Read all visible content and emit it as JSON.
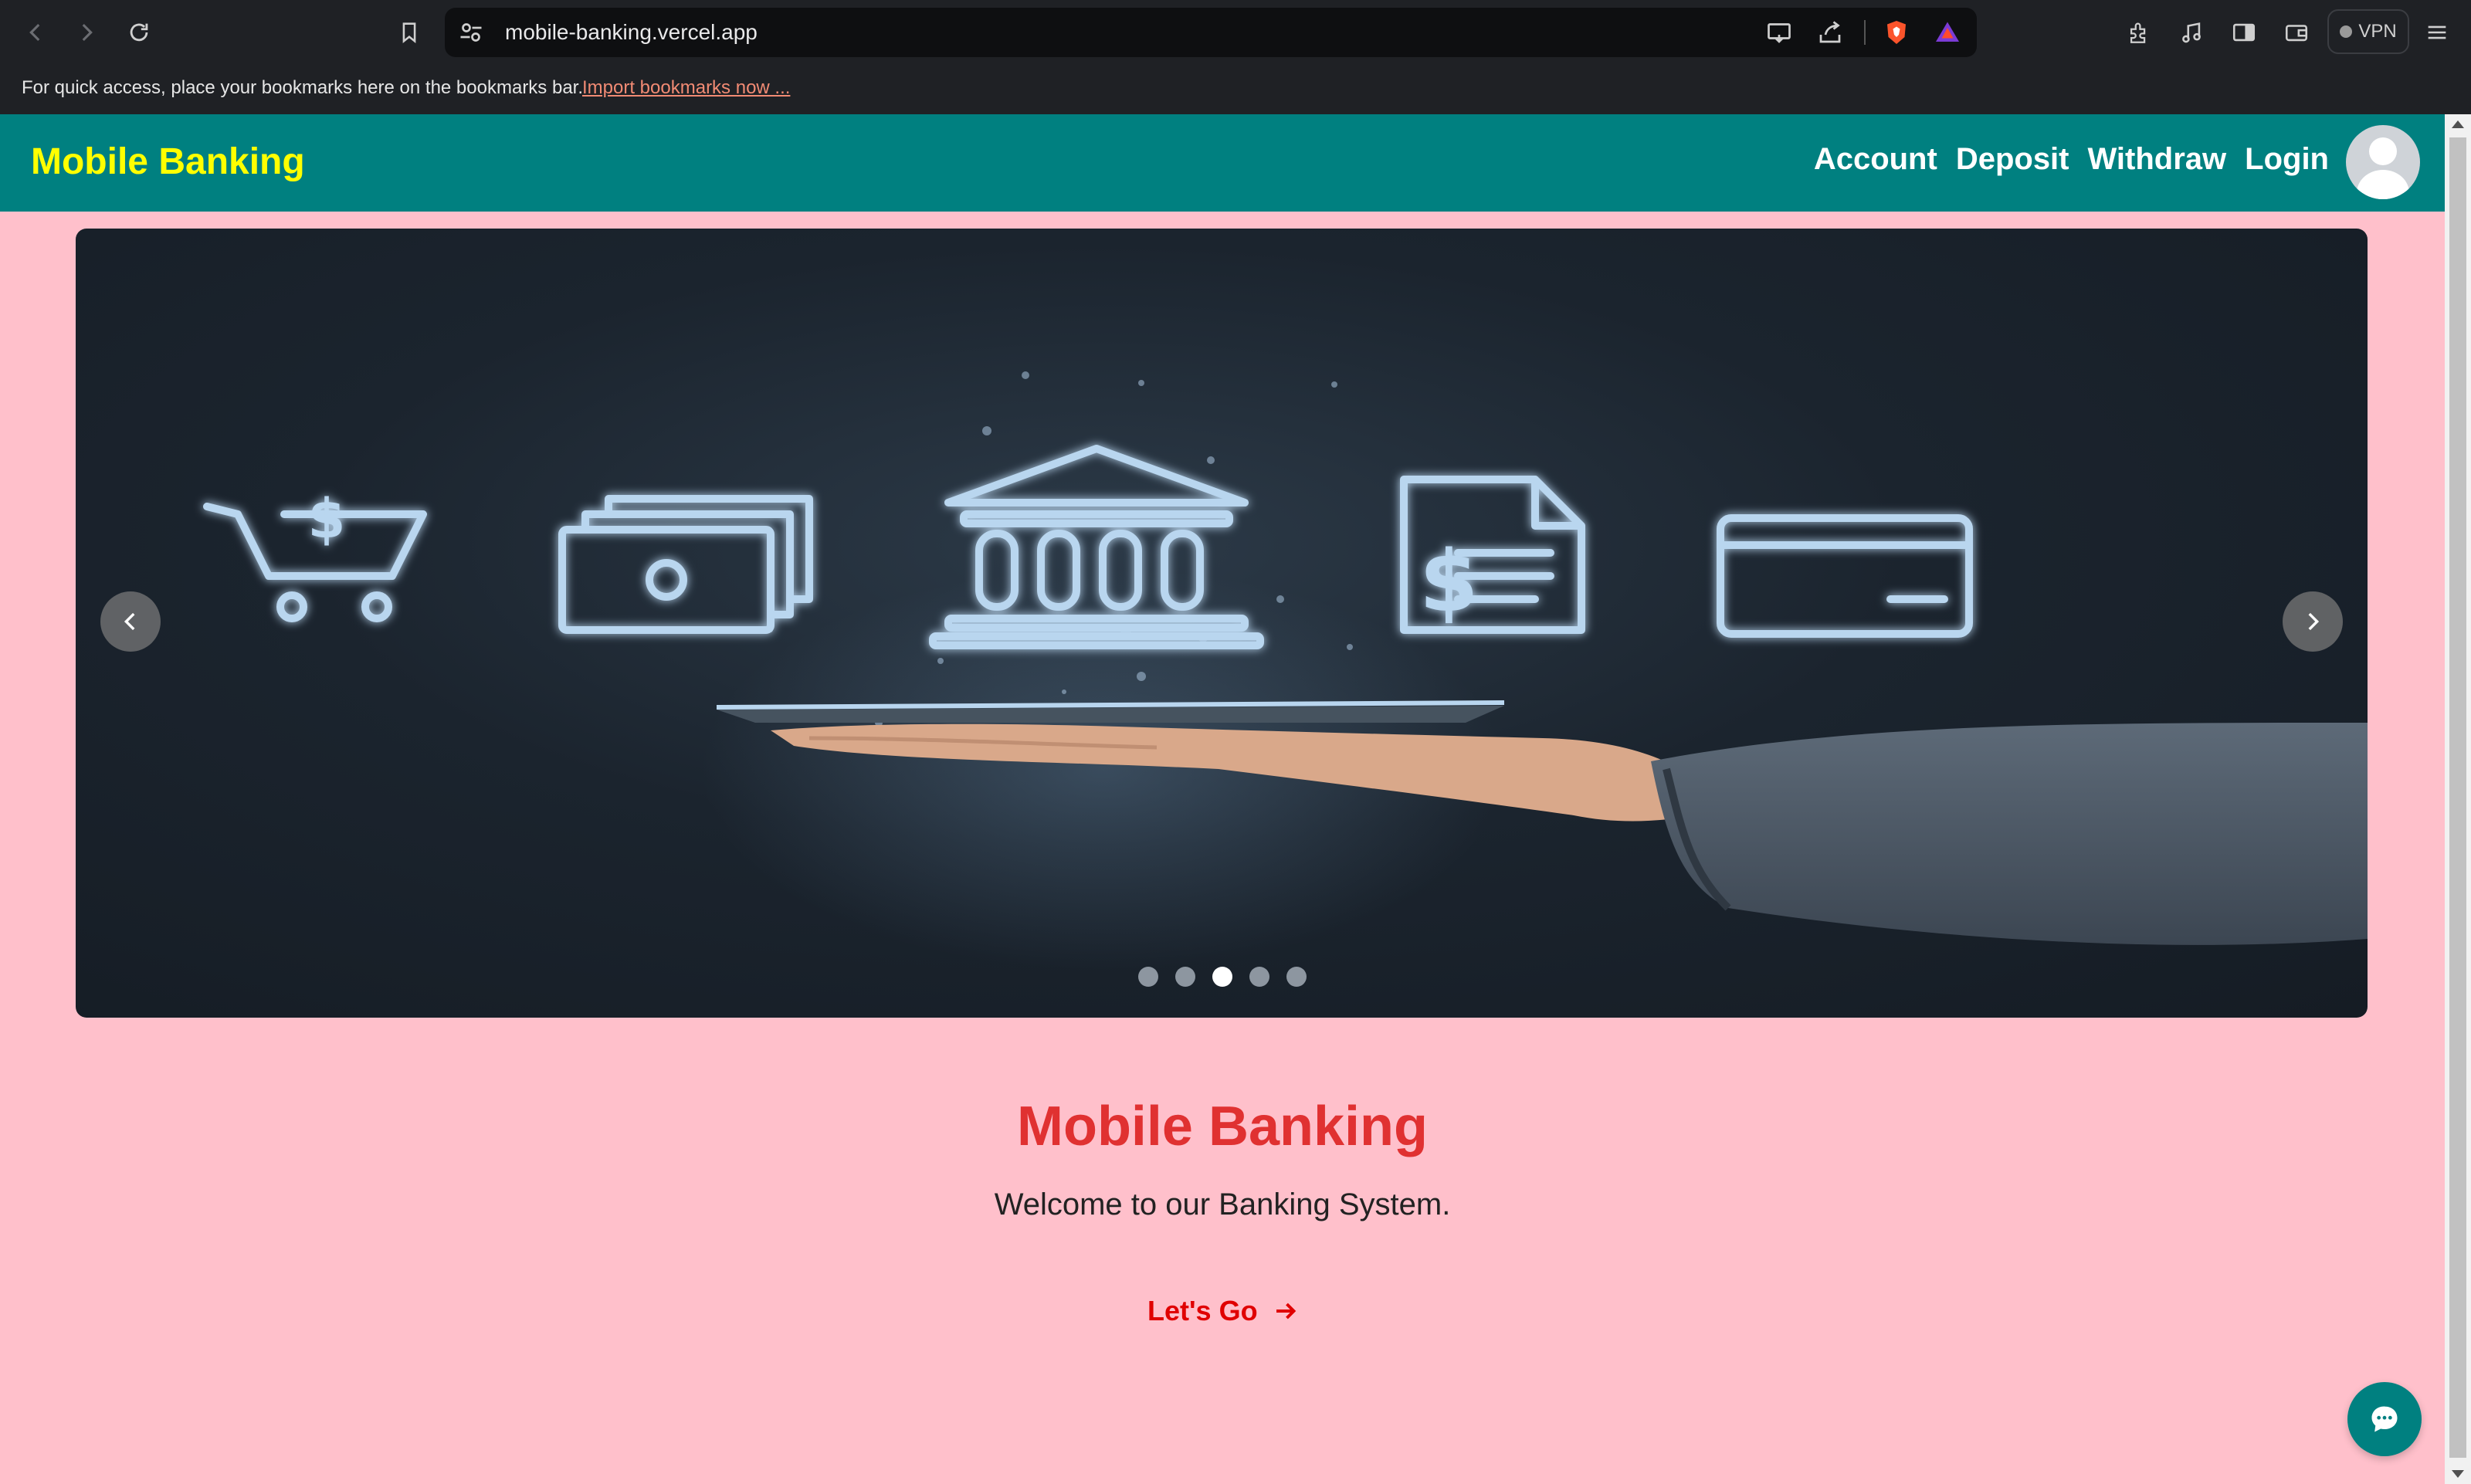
{
  "browser": {
    "url": "mobile-banking.vercel.app",
    "vpn_label": "VPN",
    "bookmarks_message": "For quick access, place your bookmarks here on the bookmarks bar.",
    "import_link": "Import bookmarks now ..."
  },
  "navbar": {
    "brand": "Mobile Banking",
    "links": [
      "Account",
      "Deposit",
      "Withdraw",
      "Login"
    ],
    "colors": {
      "background": "#008080",
      "brand": "#ffff00",
      "link": "#ffffff"
    }
  },
  "carousel": {
    "slide_count": 5,
    "active_index": 2,
    "slide_icons": [
      "cart-dollar-icon",
      "cash-stack-icon",
      "bank-building-icon",
      "dollar-document-icon",
      "credit-card-icon"
    ]
  },
  "hero": {
    "title": "Mobile Banking",
    "subtitle": "Welcome to our Banking System.",
    "cta_label": "Let's Go"
  },
  "colors": {
    "page_background": "#ffc0cb",
    "title": "#e03131",
    "cta": "#e00000"
  }
}
